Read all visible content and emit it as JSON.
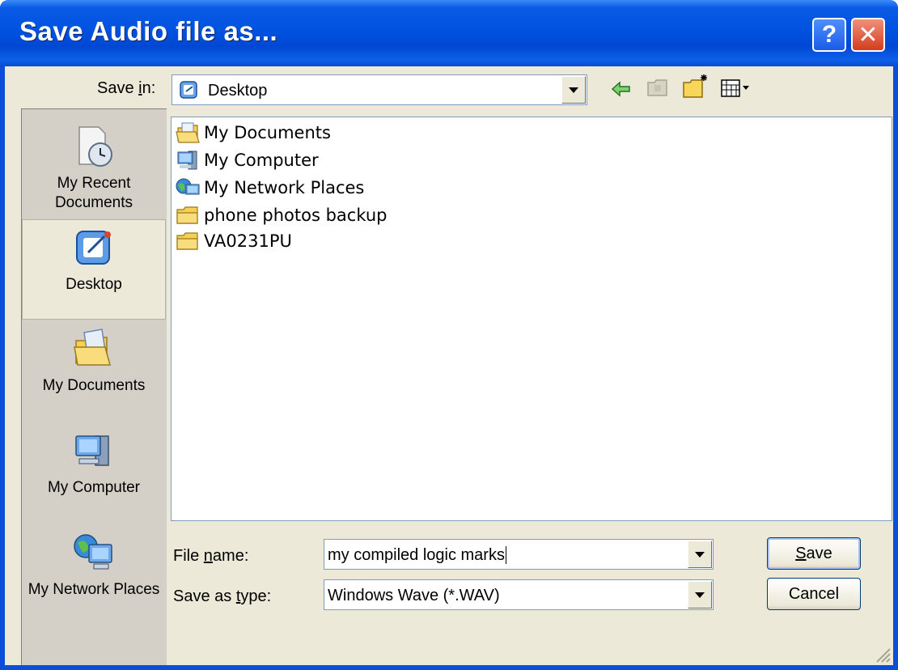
{
  "dialog": {
    "title": "Save Audio file as...",
    "help_label": "?",
    "close_label": "✕"
  },
  "save_in": {
    "label_pre": "Save ",
    "label_underlined": "i",
    "label_post": "n:",
    "value": "Desktop"
  },
  "places": [
    {
      "label": "My Recent Documents",
      "icon": "recent-documents-icon",
      "selected": false
    },
    {
      "label": "Desktop",
      "icon": "desktop-icon",
      "selected": true
    },
    {
      "label": "My Documents",
      "icon": "my-documents-icon",
      "selected": false
    },
    {
      "label": "My Computer",
      "icon": "my-computer-icon",
      "selected": false
    },
    {
      "label": "My Network Places",
      "icon": "network-places-icon",
      "selected": false
    }
  ],
  "files": [
    {
      "name": "My Documents",
      "icon": "my-documents-icon"
    },
    {
      "name": "My Computer",
      "icon": "my-computer-icon"
    },
    {
      "name": "My Network Places",
      "icon": "network-places-icon"
    },
    {
      "name": "phone photos backup",
      "icon": "folder-icon"
    },
    {
      "name": "VA0231PU",
      "icon": "folder-icon"
    }
  ],
  "file_name": {
    "label_pre": "File ",
    "label_underlined": "n",
    "label_post": "ame:",
    "value": "my compiled logic marks"
  },
  "save_type": {
    "label_pre": "Save as ",
    "label_underlined": "t",
    "label_post": "ype:",
    "value": "Windows Wave (*.WAV)"
  },
  "buttons": {
    "save_underlined": "S",
    "save_rest": "ave",
    "cancel": "Cancel"
  },
  "colors": {
    "titlebar": "#0052e0",
    "dialog_face": "#ece9d8",
    "close_button": "#d43c1f"
  }
}
